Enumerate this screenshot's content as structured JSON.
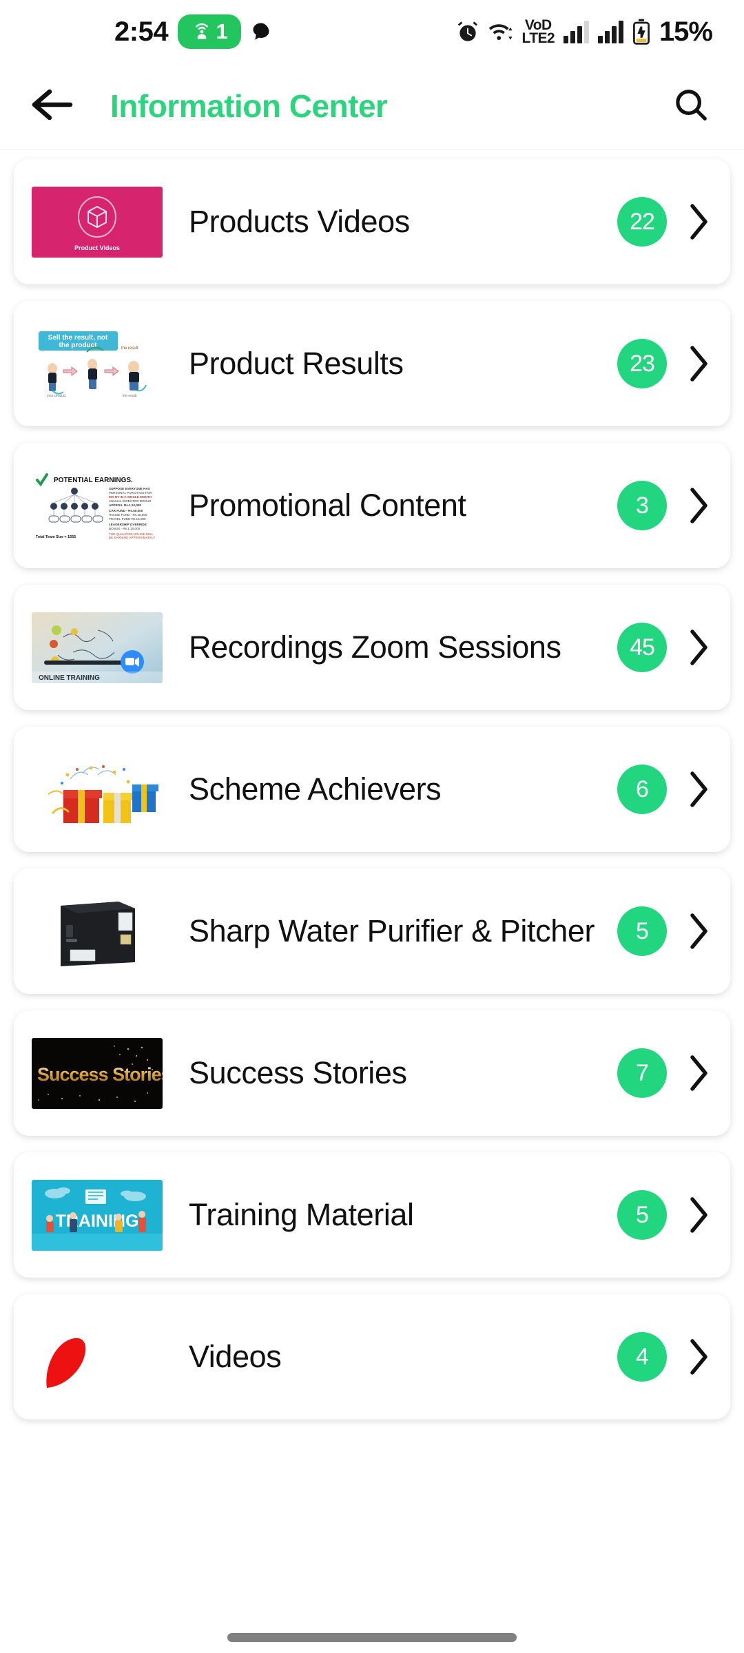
{
  "status_bar": {
    "time": "2:54",
    "hotspot_icon": "hotspot-icon",
    "hotspot_count": "1",
    "chat_icon": "chat-bubble-icon",
    "alarm_icon": "alarm-clock-icon",
    "wifi_icon": "wifi-icon",
    "network_line1": "VoD",
    "network_line2": "LTE2",
    "signal_icon_1": "signal-bars-icon",
    "signal_icon_2": "signal-bars-icon",
    "battery_icon": "battery-charging-icon",
    "battery_percent": "15%"
  },
  "header": {
    "back_icon": "back-arrow-icon",
    "title": "Information Center",
    "title_color": "#2dd47e",
    "search_icon": "search-icon"
  },
  "colors": {
    "accent_green": "#2dd47e",
    "badge_green": "#22d67f",
    "hotspot_green": "#22c55e",
    "card_bg": "#ffffff",
    "page_bg": "#ffffff"
  },
  "list": {
    "items": [
      {
        "title": "Products Videos",
        "count": "22",
        "thumb_name": "product-videos-thumbnail",
        "thumb_kind": "product-videos",
        "thumb_caption": "Product Videos",
        "thumb_bg": "#d6246e",
        "chevron_icon": "chevron-right-icon"
      },
      {
        "title": "Product Results",
        "count": "23",
        "thumb_name": "product-results-thumbnail",
        "thumb_kind": "sell-the-result",
        "thumb_caption": "Sell the result, not the product",
        "thumb_bg": "#ffffff",
        "chevron_icon": "chevron-right-icon"
      },
      {
        "title": "Promotional Content",
        "count": "3",
        "thumb_name": "promotional-content-thumbnail",
        "thumb_kind": "potential-earnings",
        "thumb_caption": "POTENTIAL EARNINGS",
        "thumb_bg": "#ffffff",
        "chevron_icon": "chevron-right-icon"
      },
      {
        "title": "Recordings Zoom Sessions",
        "count": "45",
        "thumb_name": "recordings-zoom-sessions-thumbnail",
        "thumb_kind": "online-training",
        "thumb_caption": "ONLINE TRAINING",
        "thumb_bg": "#e8dfc8",
        "chevron_icon": "chevron-right-icon"
      },
      {
        "title": "Scheme Achievers",
        "count": "6",
        "thumb_name": "scheme-achievers-thumbnail",
        "thumb_kind": "gifts",
        "thumb_caption": "",
        "thumb_bg": "#ffffff",
        "chevron_icon": "chevron-right-icon"
      },
      {
        "title": "Sharp Water Purifier & Pitcher",
        "count": "5",
        "thumb_name": "sharp-water-purifier-thumbnail",
        "thumb_kind": "purifier",
        "thumb_caption": "",
        "thumb_bg": "#ffffff",
        "chevron_icon": "chevron-right-icon"
      },
      {
        "title": "Success Stories",
        "count": "7",
        "thumb_name": "success-stories-thumbnail",
        "thumb_kind": "success-stories",
        "thumb_caption": "Success Stories",
        "thumb_bg": "#000000",
        "chevron_icon": "chevron-right-icon"
      },
      {
        "title": "Training Material",
        "count": "5",
        "thumb_name": "training-material-thumbnail",
        "thumb_kind": "training",
        "thumb_caption": "TRAINING",
        "thumb_bg": "#17a8c9",
        "chevron_icon": "chevron-right-icon"
      },
      {
        "title": "Videos",
        "count": "4",
        "thumb_name": "videos-thumbnail",
        "thumb_kind": "videos",
        "thumb_caption": "",
        "thumb_bg": "#ffffff",
        "chevron_icon": "chevron-right-icon"
      }
    ]
  },
  "nav": {
    "gesture_pill": "home-gesture-pill"
  }
}
